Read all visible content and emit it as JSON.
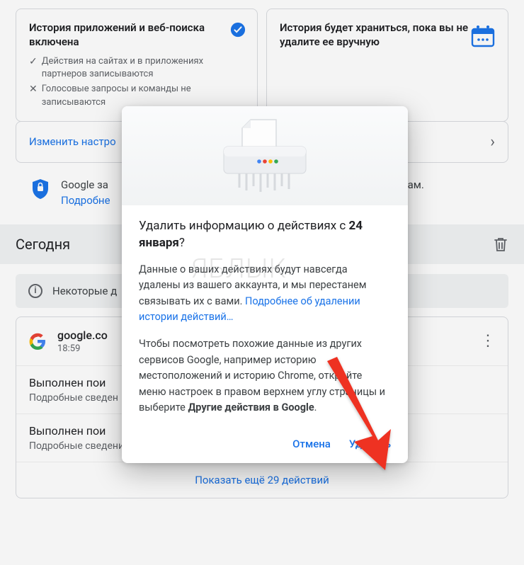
{
  "cards": {
    "left": {
      "title": "История приложений и веб-поиска включена",
      "sub1": "Действия на сайтах и в приложениях партнеров записываются",
      "sub2": "Голосовые запросы и команды не записываются"
    },
    "right": {
      "title": "История будет храниться, пока вы не удалите ее вручную"
    }
  },
  "link_bar": "Изменить настро",
  "protect": {
    "line1": "Google за",
    "line2_end": "о вам.",
    "link": "Подробне"
  },
  "section": {
    "title": "Сегодня"
  },
  "notice": "Некоторые д",
  "activity": {
    "site": "google.co",
    "time": "18:59",
    "row1_title": "Выполнен пои",
    "row1_sub": "Подробные сведен",
    "row2_title": "Выполнен пои",
    "row2_sub": "Подробные сведения",
    "show_more": "Показать ещё 29 действий"
  },
  "dialog": {
    "title_pre": "Удалить информацию о действиях с ",
    "title_date": "24 января",
    "title_q": "?",
    "p1_pre": "Данные о ваших действиях будут навсегда удалены из вашего аккаунта, и мы перестанем связывать их с вами. ",
    "p1_link": "Подробнее об удалении истории действий…",
    "p2_pre": "Чтобы посмотреть похожие данные из других сервисов Google, например историю местоположений и историю Chrome, откройте меню настроек в правом верхнем углу страницы и выберите ",
    "p2_bold": "Другие действия в Google",
    "p2_end": ".",
    "cancel": "Отмена",
    "delete": "Удалить"
  },
  "watermark": "ЯБЛЫК"
}
